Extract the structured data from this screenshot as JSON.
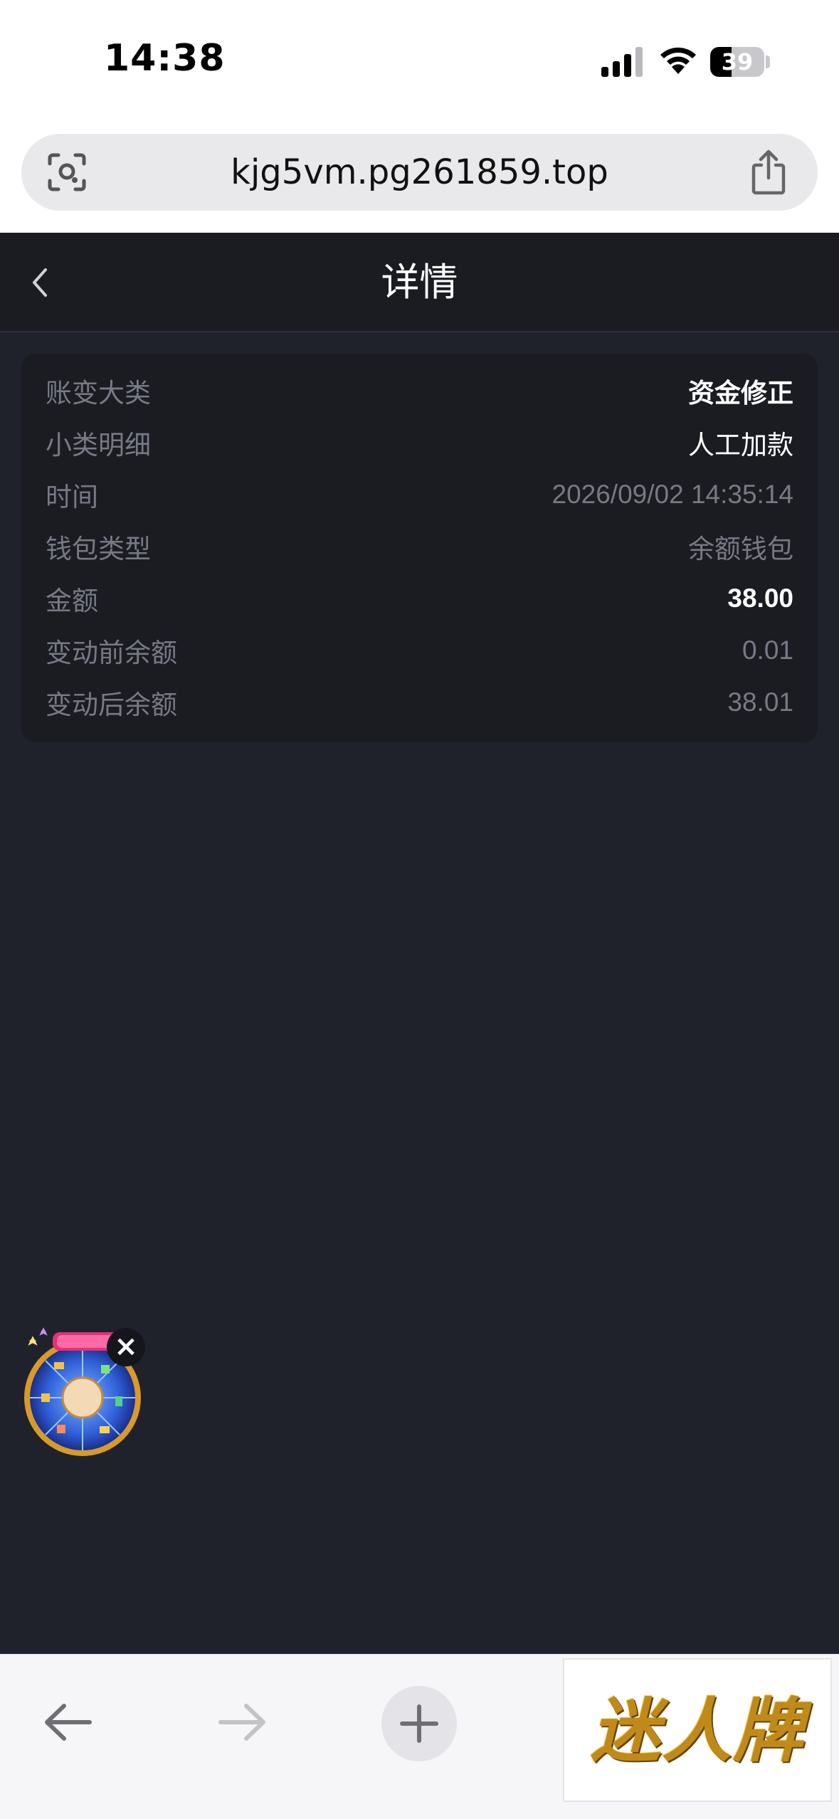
{
  "status_bar": {
    "time": "14:38",
    "battery_percent": 39
  },
  "browser": {
    "url": "kjg5vm.pg261859.top"
  },
  "page": {
    "title": "详情"
  },
  "details": {
    "rows": [
      {
        "label": "账变大类",
        "value": "资金修正",
        "emphasis": "bold-white"
      },
      {
        "label": "小类明细",
        "value": "人工加款",
        "emphasis": "white"
      },
      {
        "label": "时间",
        "value": "2026/09/02 14:35:14",
        "emphasis": "muted"
      },
      {
        "label": "钱包类型",
        "value": "余额钱包",
        "emphasis": "muted"
      },
      {
        "label": "金额",
        "value": "38.00",
        "emphasis": "bold-white"
      },
      {
        "label": "变动前余额",
        "value": "0.01",
        "emphasis": "muted"
      },
      {
        "label": "变动后余额",
        "value": "38.01",
        "emphasis": "muted"
      }
    ]
  },
  "floating_widget": {
    "icon": "lucky-wheel-icon",
    "close_label": "×"
  },
  "toolbar": {
    "logo_text": "迷人牌"
  },
  "colors": {
    "app_background": "#20222b",
    "card_background": "#1b1c22",
    "muted_text": "#777a85",
    "strong_text": "#ffffff"
  }
}
